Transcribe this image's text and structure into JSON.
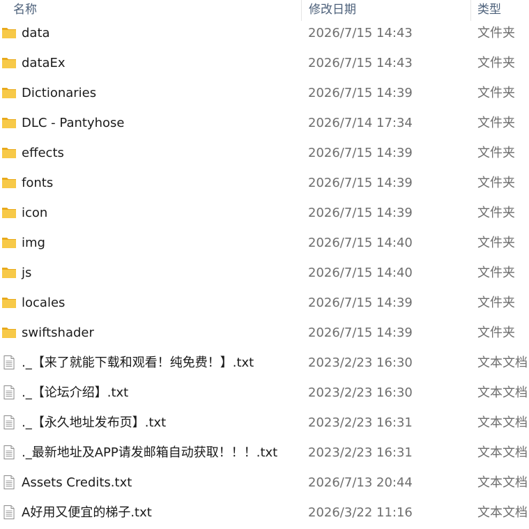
{
  "columns": {
    "name": "名称",
    "date": "修改日期",
    "type": "类型"
  },
  "files": [
    {
      "name": "data",
      "date": "2026/7/15 14:43",
      "type": "文件夹",
      "icon": "folder-icon"
    },
    {
      "name": "dataEx",
      "date": "2026/7/15 14:43",
      "type": "文件夹",
      "icon": "folder-icon"
    },
    {
      "name": "Dictionaries",
      "date": "2026/7/15 14:39",
      "type": "文件夹",
      "icon": "folder-icon"
    },
    {
      "name": "DLC - Pantyhose",
      "date": "2026/7/14 17:34",
      "type": "文件夹",
      "icon": "folder-icon"
    },
    {
      "name": "effects",
      "date": "2026/7/15 14:39",
      "type": "文件夹",
      "icon": "folder-icon"
    },
    {
      "name": "fonts",
      "date": "2026/7/15 14:39",
      "type": "文件夹",
      "icon": "folder-icon"
    },
    {
      "name": "icon",
      "date": "2026/7/15 14:39",
      "type": "文件夹",
      "icon": "folder-icon"
    },
    {
      "name": "img",
      "date": "2026/7/15 14:40",
      "type": "文件夹",
      "icon": "folder-icon"
    },
    {
      "name": "js",
      "date": "2026/7/15 14:40",
      "type": "文件夹",
      "icon": "folder-icon"
    },
    {
      "name": "locales",
      "date": "2026/7/15 14:39",
      "type": "文件夹",
      "icon": "folder-icon"
    },
    {
      "name": "swiftshader",
      "date": "2026/7/15 14:39",
      "type": "文件夹",
      "icon": "folder-icon"
    },
    {
      "name": "._【来了就能下载和观看！纯免费！】.txt",
      "date": "2023/2/23 16:30",
      "type": "文本文档",
      "icon": "text-file-icon"
    },
    {
      "name": "._【论坛介绍】.txt",
      "date": "2023/2/23 16:30",
      "type": "文本文档",
      "icon": "text-file-icon"
    },
    {
      "name": "._【永久地址发布页】.txt",
      "date": "2023/2/23 16:31",
      "type": "文本文档",
      "icon": "text-file-icon"
    },
    {
      "name": "._最新地址及APP请发邮箱自动获取！！！.txt",
      "date": "2023/2/23 16:31",
      "type": "文本文档",
      "icon": "text-file-icon"
    },
    {
      "name": "Assets Credits.txt",
      "date": "2026/7/13 20:44",
      "type": "文本文档",
      "icon": "text-file-icon"
    },
    {
      "name": "A好用又便宜的梯子.txt",
      "date": "2026/3/22 11:16",
      "type": "文本文档",
      "icon": "text-file-icon"
    }
  ],
  "colors": {
    "folder_body": "#f7c948",
    "folder_tab": "#e8a91c",
    "header_text": "#4c607a",
    "meta_text": "#6e6e6e"
  }
}
